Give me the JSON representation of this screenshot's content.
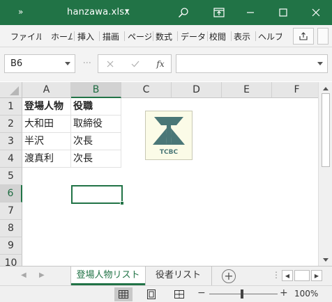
{
  "titlebar": {
    "quick_access": "»",
    "title": "hanzawa.xlsx",
    "title_caret": "▾",
    "color": "#217346"
  },
  "ribbon": {
    "tabs": [
      "ファイル",
      "ホーム",
      "挿入",
      "描画",
      "ページ",
      "数式",
      "データ",
      "校閲",
      "表示",
      "ヘルプ"
    ]
  },
  "formula_bar": {
    "name_box": "B6",
    "fx": "fx",
    "value": ""
  },
  "sheet": {
    "columns": [
      "A",
      "B",
      "C",
      "D",
      "E",
      "F"
    ],
    "rows": [
      "1",
      "2",
      "3",
      "4",
      "5",
      "6",
      "7",
      "8",
      "9",
      "10"
    ],
    "cells": {
      "A1": "登場人物",
      "B1": "役職",
      "A2": "大和田",
      "B2": "取締役",
      "A3": "半沢",
      "B3": "次長",
      "A4": "渡真利",
      "B4": "次長"
    },
    "selected_cell": "B6",
    "logo_text": "TCBC"
  },
  "tabs": {
    "sheets": [
      "登場人物リスト",
      "役者リスト"
    ],
    "add": "+"
  },
  "status": {
    "zoom": "100%",
    "zoom_minus": "−",
    "zoom_plus": "+"
  }
}
